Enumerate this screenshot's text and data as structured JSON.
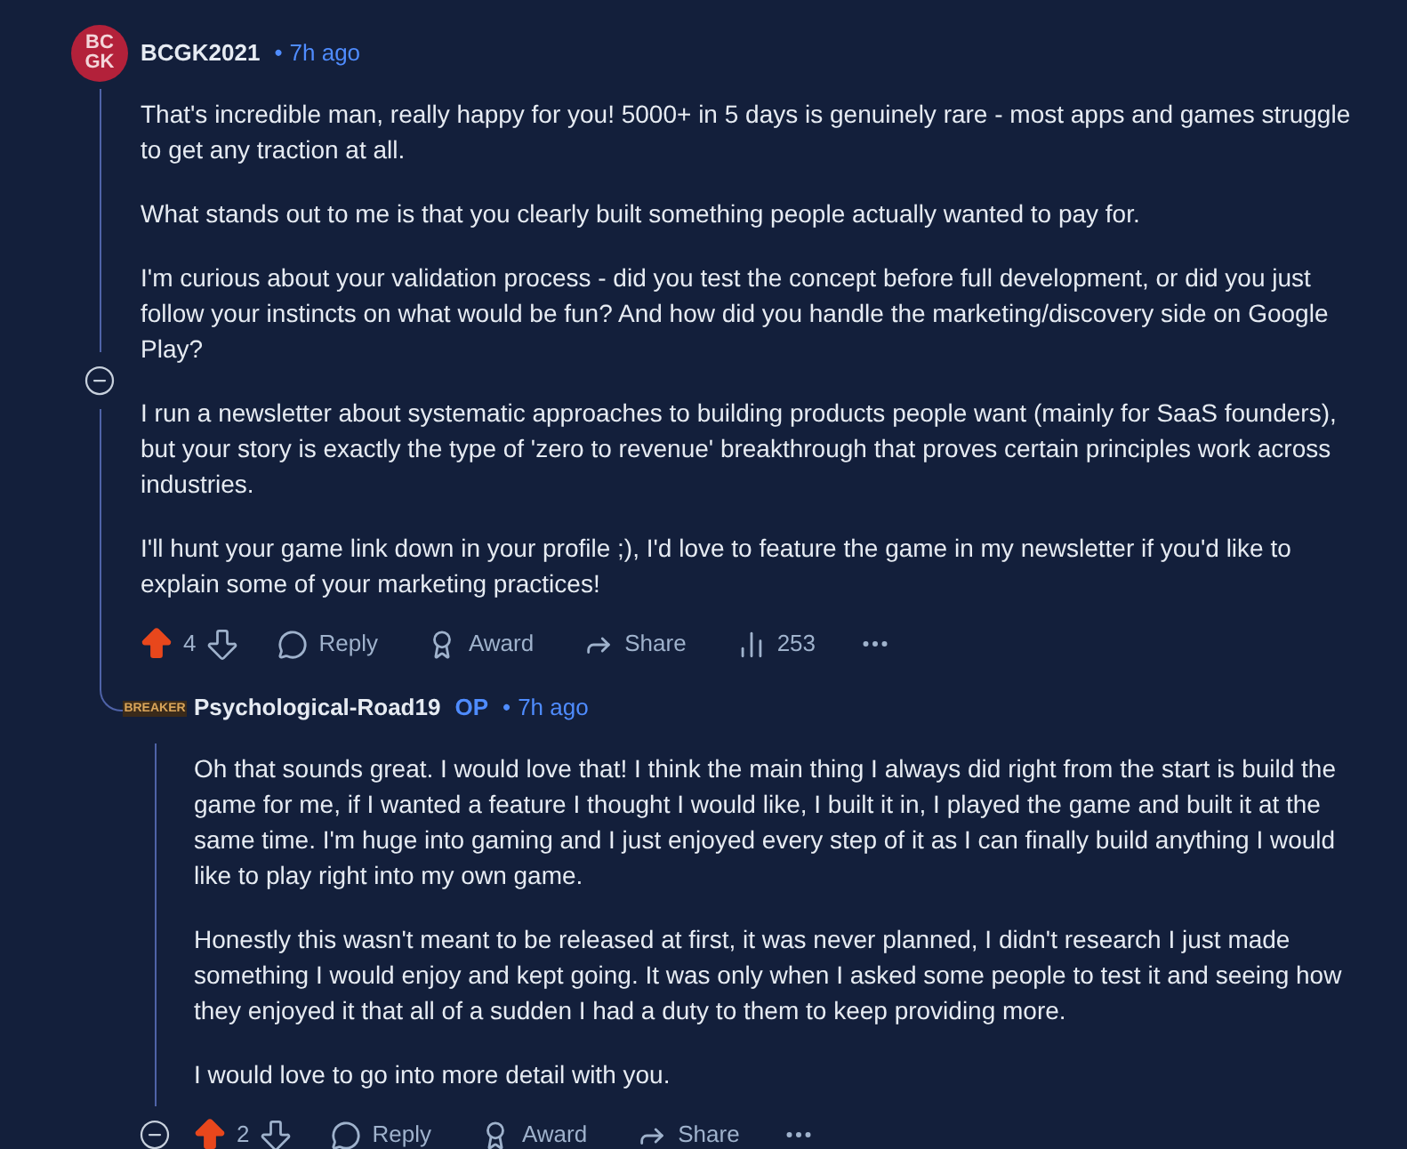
{
  "comments": [
    {
      "author": "BCGK2021",
      "avatar": {
        "kind": "initials",
        "text": [
          "BC",
          "GK"
        ]
      },
      "separator": "•",
      "time": "7h ago",
      "paragraphs": [
        "That's incredible man, really happy for you! 5000+ in 5 days is genuinely rare - most apps and games struggle to get any traction at all.",
        "What stands out to me is that you clearly built something people actually wanted to pay for.",
        "I'm curious about your validation process - did you test the concept before full development, or did you just follow your instincts on what would be fun? And how did you handle the marketing/discovery side on Google Play?",
        "I run a newsletter about systematic approaches to building products people want (mainly for SaaS founders), but your story is exactly the type of 'zero to revenue' breakthrough that proves certain principles work across industries.",
        "I'll hunt your game link down in your profile ;), I'd love to feature the game in my newsletter if you'd like to explain some of your marketing practices!"
      ],
      "upvoted": true,
      "votes": "4",
      "actions": {
        "reply": "Reply",
        "award": "Award",
        "share": "Share",
        "views": "253"
      }
    },
    {
      "author": "Psychological-Road19",
      "avatar": {
        "kind": "logo",
        "text": [
          "BREAKER"
        ]
      },
      "op_label": "OP",
      "separator": "•",
      "time": "7h ago",
      "paragraphs": [
        "Oh that sounds great. I would love that! I think the main thing I always did right from the start is build the game for me, if I wanted a feature I thought I would like, I built it in, I played the game and built it at the same time. I'm huge into gaming and I just enjoyed every step of it as I can finally build anything I would like to play right into my own game.",
        "Honestly this wasn't meant to be released at first, it was never planned, I didn't research I just made something I would enjoy and kept going. It was only when I asked some people to test it and seeing how they enjoyed it that all of a sudden I had a duty to them to keep providing more.",
        "I would love to go into more detail with you."
      ],
      "upvoted": true,
      "votes": "2",
      "actions": {
        "reply": "Reply",
        "award": "Award",
        "share": "Share"
      }
    }
  ]
}
